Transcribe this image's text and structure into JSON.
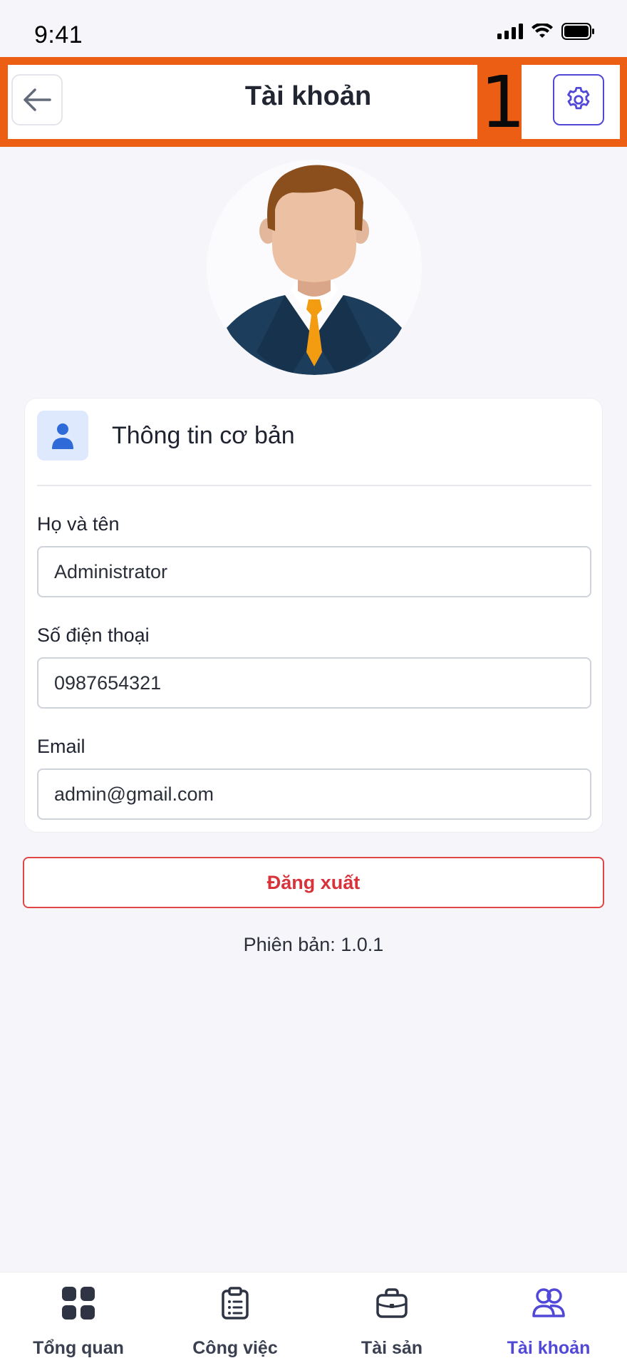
{
  "status_bar": {
    "time": "9:41"
  },
  "annotation": {
    "number": "1"
  },
  "header": {
    "title": "Tài khoản"
  },
  "card": {
    "title": "Thông tin cơ bản",
    "fields": [
      {
        "label": "Họ và tên",
        "value": "Administrator"
      },
      {
        "label": "Số điện thoại",
        "value": "0987654321"
      },
      {
        "label": "Email",
        "value": "admin@gmail.com"
      }
    ]
  },
  "logout": {
    "label": "Đăng xuất"
  },
  "version": {
    "text": "Phiên bản: 1.0.1"
  },
  "bottom_nav": {
    "items": [
      {
        "label": "Tổng quan",
        "icon": "grid-icon"
      },
      {
        "label": "Công việc",
        "icon": "clipboard-icon"
      },
      {
        "label": "Tài sản",
        "icon": "briefcase-icon"
      },
      {
        "label": "Tài khoản",
        "icon": "users-icon",
        "active": true
      }
    ]
  },
  "colors": {
    "accent": "#5148d8",
    "danger": "#d8333a",
    "annotation": "#ec5e13",
    "background": "#f6f6fa"
  }
}
